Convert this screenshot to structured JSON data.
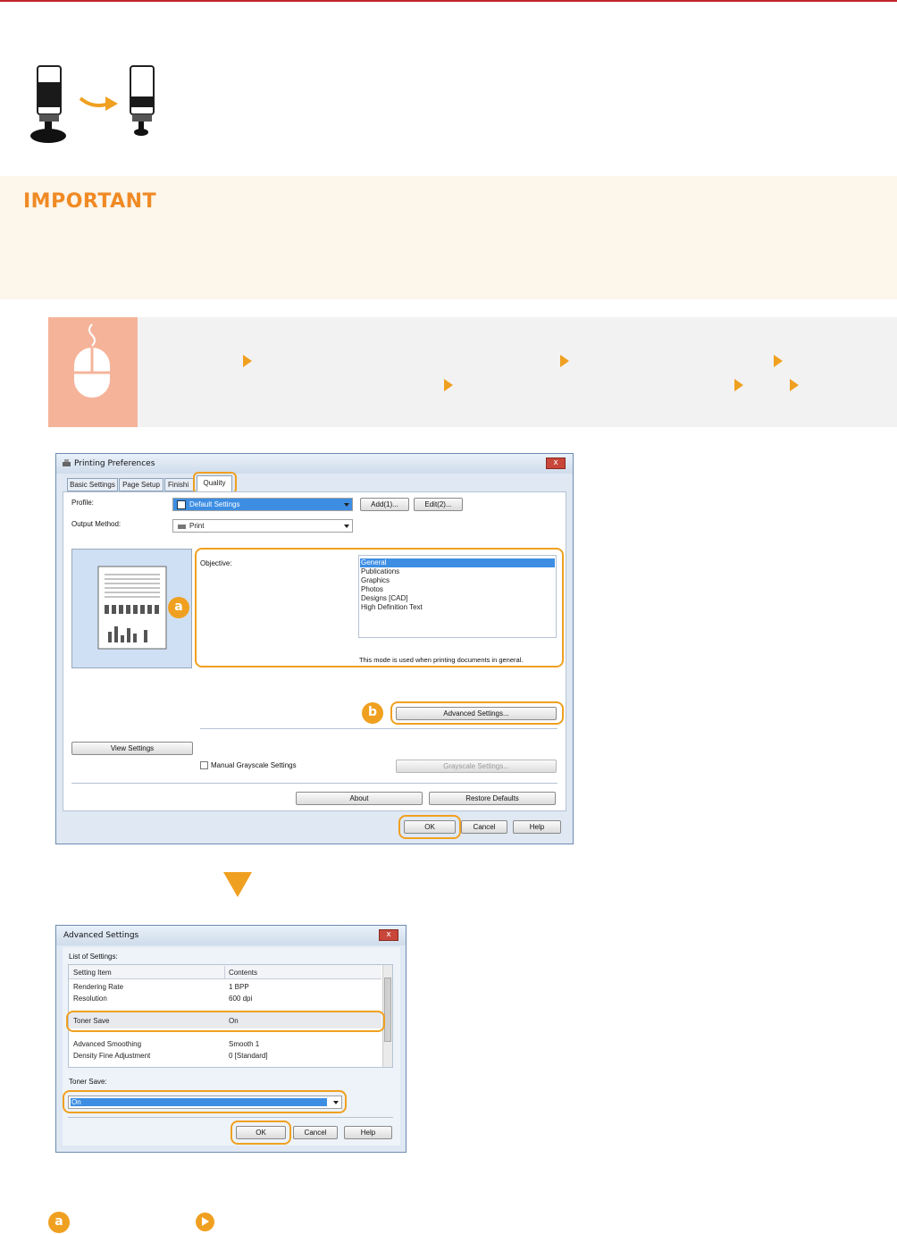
{
  "important_label": "IMPORTANT",
  "colors": {
    "accent": "#f0a020",
    "important_title": "#f08a24",
    "rule": "#c0262d"
  },
  "icons": [
    "toner-cartridge-icon",
    "arrow-right-icon",
    "mouse-icon",
    "breadcrumb-arrow-icon",
    "down-triangle-icon",
    "link-arrow-icon"
  ],
  "printing_prefs": {
    "title": "Printing Preferences",
    "close_label": "x",
    "tabs": [
      "Basic Settings",
      "Page Setup",
      "Finishi",
      "Quality"
    ],
    "profile_label": "Profile:",
    "profile_value": "Default Settings",
    "add_button": "Add(1)...",
    "edit_button": "Edit(2)...",
    "output_method_label": "Output Method:",
    "output_method_value": "Print",
    "objective_label": "Objective:",
    "objectives": [
      "General",
      "Publications",
      "Graphics",
      "Photos",
      "Designs [CAD]",
      "High Definition Text"
    ],
    "objective_description": "This mode is used when printing documents in general.",
    "advanced_settings_button": "Advanced Settings...",
    "view_settings_button": "View Settings",
    "manual_grayscale_label": "Manual Grayscale Settings",
    "grayscale_settings_button": "Grayscale Settings...",
    "about_button": "About",
    "restore_defaults_button": "Restore Defaults",
    "ok_button": "OK",
    "cancel_button": "Cancel",
    "help_button": "Help",
    "badge_a": "a",
    "badge_b": "b"
  },
  "advanced_settings": {
    "title": "Advanced Settings",
    "close_label": "x",
    "list_label": "List of Settings:",
    "col_setting_item": "Setting Item",
    "col_contents": "Contents",
    "rows": [
      {
        "item": "Rendering Rate",
        "value": "1 BPP"
      },
      {
        "item": "Resolution",
        "value": "600 dpi"
      },
      {
        "item": "Toner Save",
        "value": "On"
      },
      {
        "item": "Advanced Smoothing",
        "value": "Smooth 1"
      },
      {
        "item": "Density Fine Adjustment",
        "value": "0 [Standard]"
      }
    ],
    "toner_save_label": "Toner Save:",
    "toner_save_value": "On",
    "ok_button": "OK",
    "cancel_button": "Cancel",
    "help_button": "Help"
  },
  "footer": {
    "badge": "a"
  }
}
